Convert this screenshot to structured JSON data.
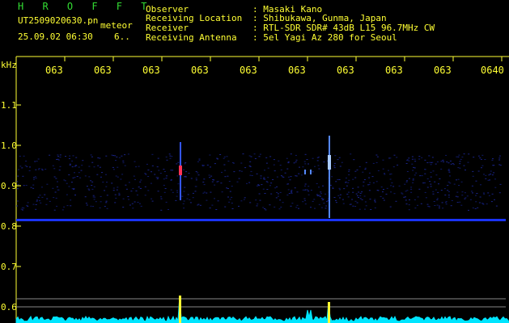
{
  "header": {
    "title": "H R O F F T",
    "filename": "UT2509020630.pn",
    "label": "meteor",
    "datetime": "25.09.02 06:30",
    "counter": "6..",
    "info": [
      {
        "key": "Observer",
        "value": ": Masaki Kano"
      },
      {
        "key": "Receiving Location",
        "value": ": Shibukawa, Gunma, Japan"
      },
      {
        "key": "Receiver",
        "value": ": RTL-SDR SDR# 43dB L15 96.7MHz CW"
      },
      {
        "key": "Receiving Antenna",
        "value": ": 5el Yagi Az 280 for Seoul"
      }
    ]
  },
  "axis": {
    "unit": "kHz",
    "y_ticks": [
      "1.1",
      "1.0",
      "0.9",
      "0.8",
      "0.7",
      "0.6"
    ],
    "x_ticks": [
      "063",
      "063",
      "063",
      "063",
      "063",
      "063",
      "063",
      "063",
      "063",
      "0640"
    ]
  },
  "colors": {
    "background": "#000000",
    "text_yellow": "#ffff33",
    "title_green": "#33dd33",
    "signal_blue": "#1a33ff",
    "trace_cyan": "#00e5ff"
  }
}
